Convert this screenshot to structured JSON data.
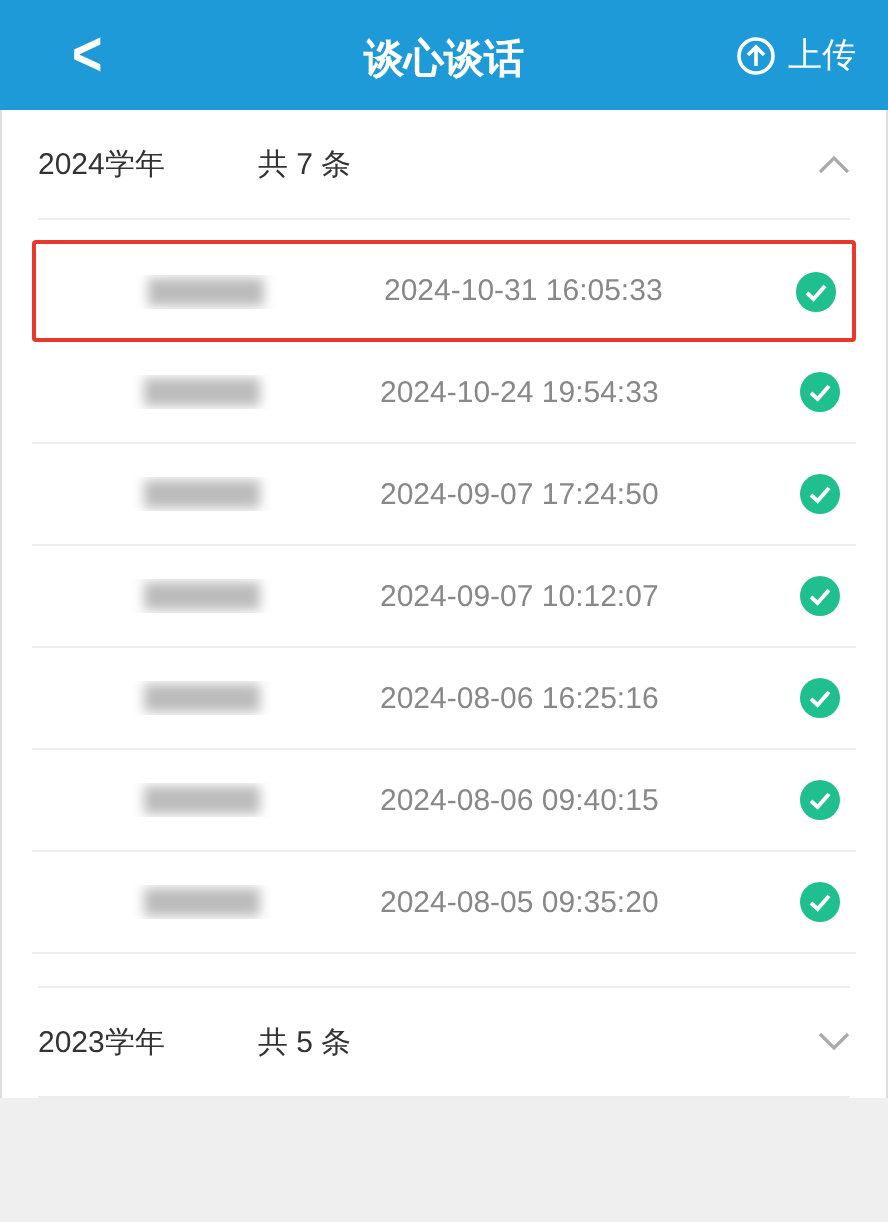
{
  "header": {
    "back": "<",
    "title": "谈心谈话",
    "action": "上传"
  },
  "years": [
    {
      "year": "2024学年",
      "count": "共 7 条",
      "expanded": true,
      "records": [
        {
          "time": "2024-10-31 16:05:33",
          "done": true,
          "selected": true
        },
        {
          "time": "2024-10-24 19:54:33",
          "done": true,
          "selected": false
        },
        {
          "time": "2024-09-07 17:24:50",
          "done": true,
          "selected": false
        },
        {
          "time": "2024-09-07 10:12:07",
          "done": true,
          "selected": false
        },
        {
          "time": "2024-08-06 16:25:16",
          "done": true,
          "selected": false
        },
        {
          "time": "2024-08-06 09:40:15",
          "done": true,
          "selected": false
        },
        {
          "time": "2024-08-05 09:35:20",
          "done": true,
          "selected": false
        }
      ]
    },
    {
      "year": "2023学年",
      "count": "共 5 条",
      "expanded": false
    }
  ]
}
